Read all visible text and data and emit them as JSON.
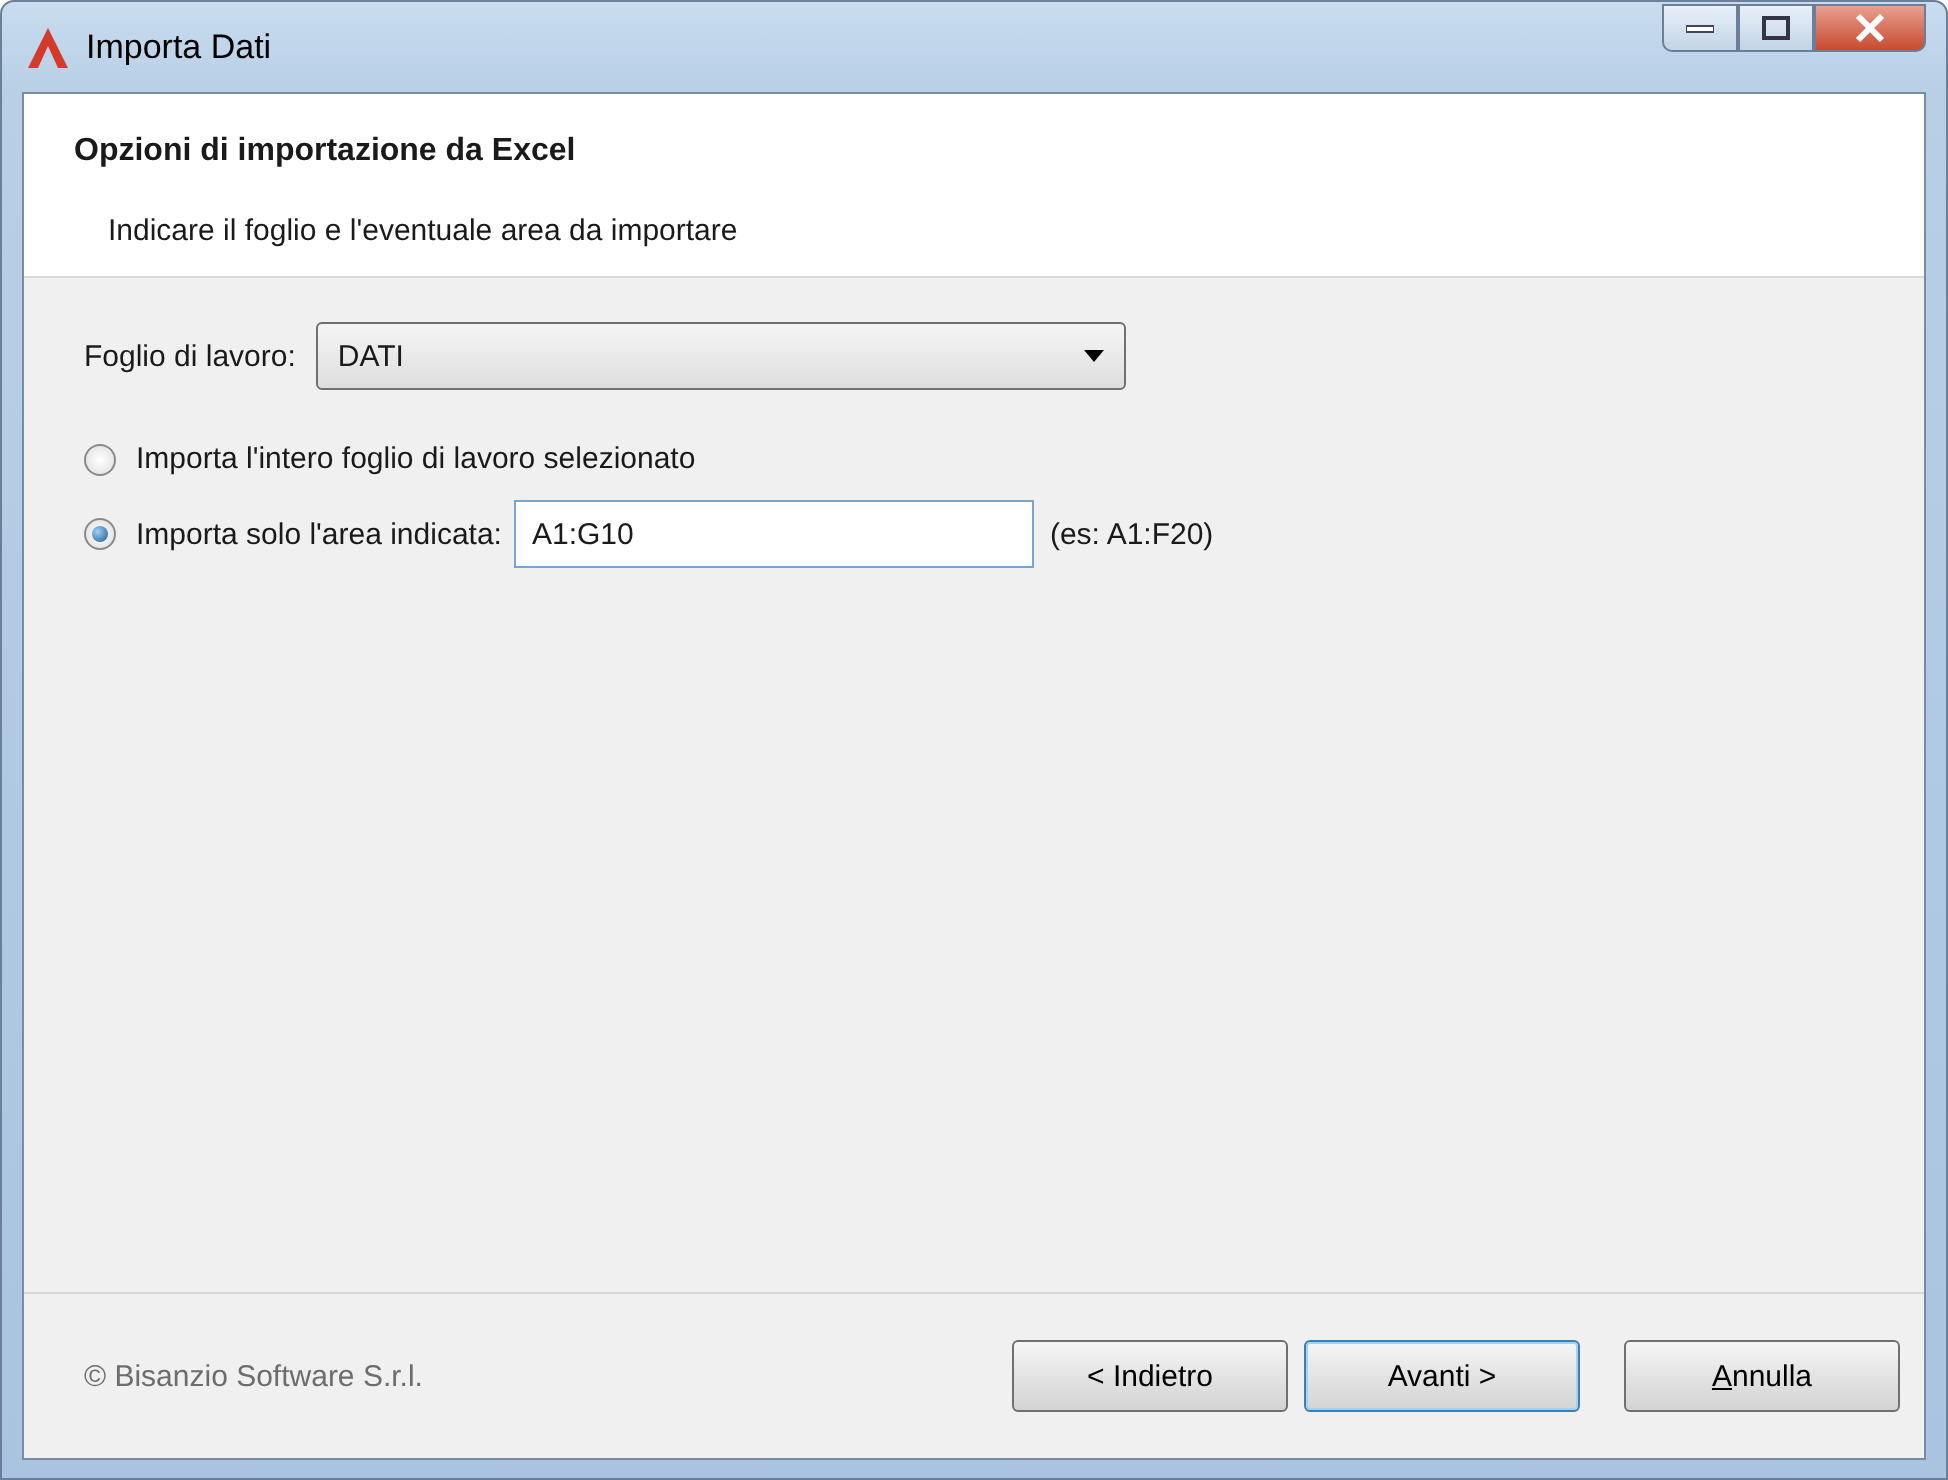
{
  "window": {
    "title": "Importa Dati"
  },
  "header": {
    "title": "Opzioni di importazione da Excel",
    "subtitle": "Indicare il foglio e l'eventuale area da importare"
  },
  "worksheet": {
    "label": "Foglio di lavoro:",
    "value": "DATI"
  },
  "options": [
    {
      "label": "Importa l'intero foglio di lavoro selezionato",
      "selected": false
    },
    {
      "label": "Importa solo l'area indicata:",
      "selected": true,
      "field": {
        "value": "A1:G10",
        "focused": true
      },
      "hint": "(es: A1:F20)"
    }
  ],
  "footer": {
    "copyright": "© Bisanzio Software S.r.l."
  },
  "buttons": [
    {
      "label": "< Indietro",
      "default": false,
      "mnemonic": false
    },
    {
      "label": "Avanti >",
      "default": true,
      "mnemonic": false
    },
    {
      "label": "Annulla",
      "default": false,
      "mnemonic": true
    }
  ]
}
